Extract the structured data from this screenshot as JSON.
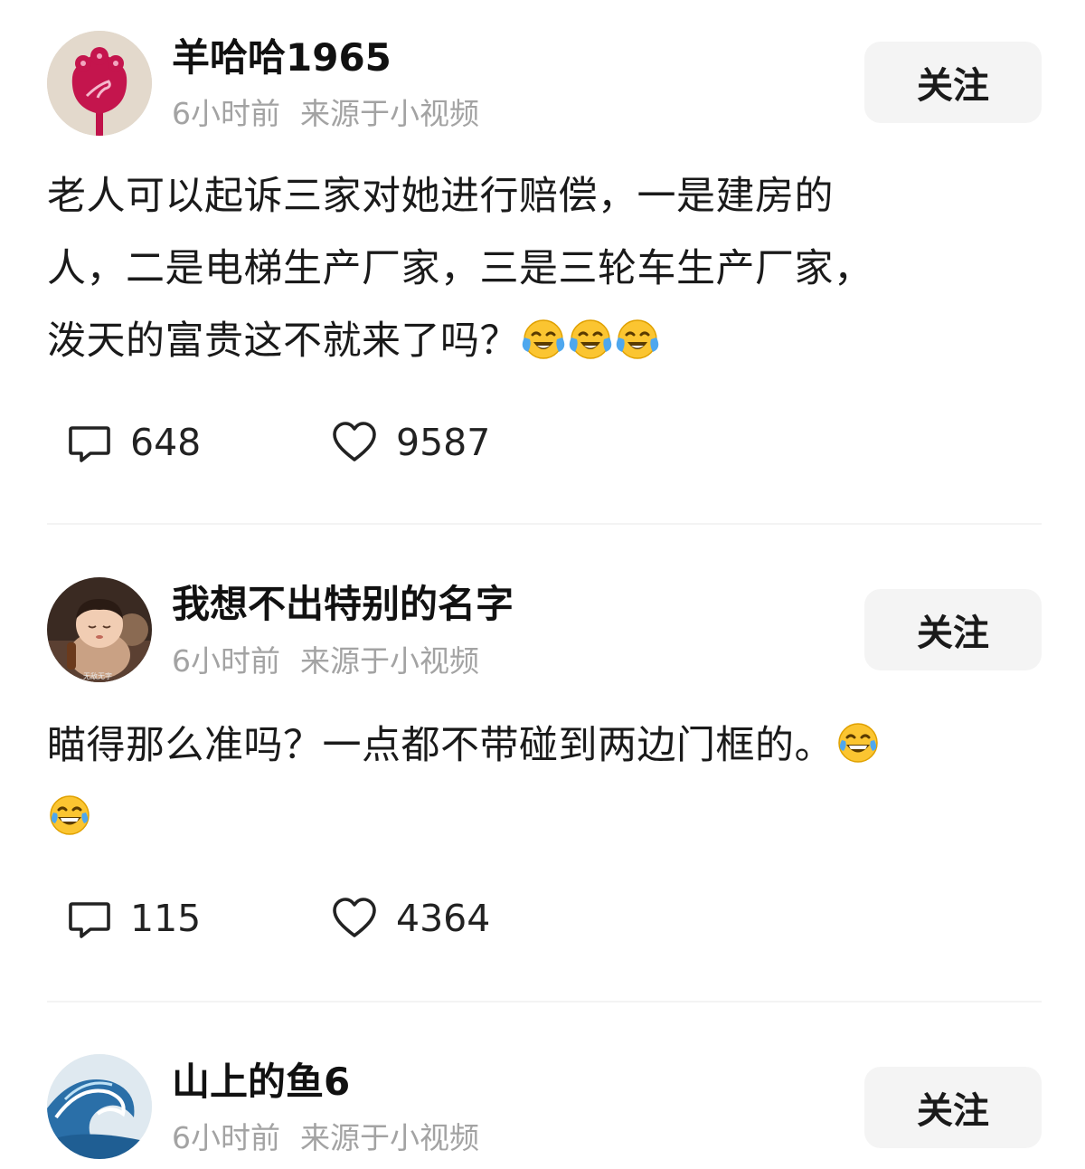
{
  "posts": [
    {
      "username": "羊哈哈1965",
      "time": "6小时前",
      "source": "来源于小视频",
      "follow_label": "关注",
      "lines": [
        "老人可以起诉三家对她进行赔偿，一是建房的",
        "人，二是电梯生产厂家，三是三轮车生产厂家，",
        "泼天的富贵这不就来了吗？"
      ],
      "emojis": [
        "crying-laughing-emoji",
        "crying-laughing-emoji",
        "crying-laughing-emoji"
      ],
      "comment_count": "648",
      "like_count": "9587"
    },
    {
      "username": "我想不出特别的名字",
      "time": "6小时前",
      "source": "来源于小视频",
      "follow_label": "关注",
      "avatar_caption": "无敌无字",
      "lines": [
        "瞄得那么准吗？一点都不带碰到两边门框的。"
      ],
      "emojis": [
        "tears-of-joy-emoji",
        "tears-of-joy-emoji"
      ],
      "comment_count": "115",
      "like_count": "4364"
    },
    {
      "username": "山上的鱼6",
      "time": "6小时前",
      "source": "来源于小视频",
      "follow_label": "关注"
    }
  ],
  "icons": {
    "comment": "comment-bubble-icon",
    "like": "heart-outline-icon"
  },
  "colors": {
    "text": "#1a1a1a",
    "meta": "#a3a3a3",
    "follow_bg": "#f4f4f4"
  }
}
